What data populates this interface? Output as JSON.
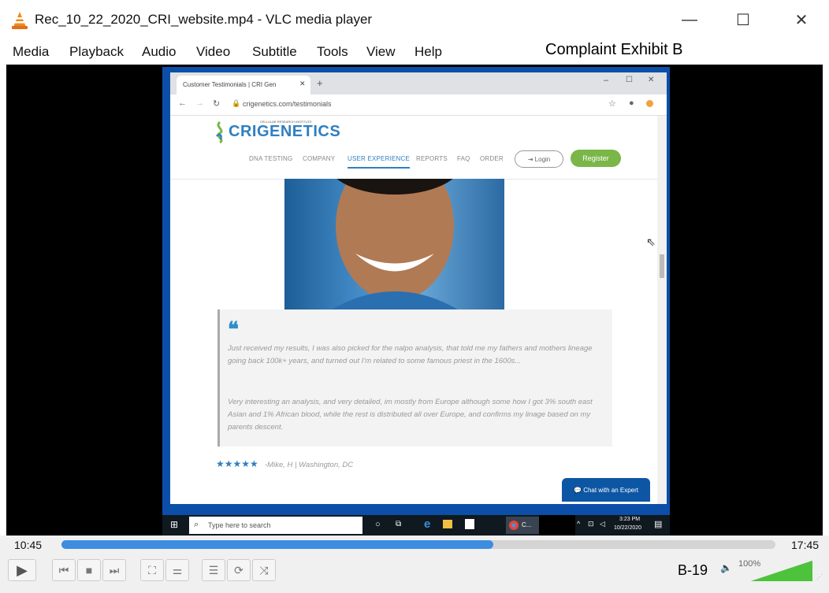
{
  "window": {
    "title": "Rec_10_22_2020_CRI_website.mp4 - VLC media player",
    "controls": [
      "—",
      "☐",
      "✕"
    ]
  },
  "menubar": {
    "items": [
      "Media",
      "Playback",
      "Audio",
      "Video",
      "Subtitle",
      "Tools",
      "View",
      "Help"
    ]
  },
  "exhibit_label": "Complaint Exhibit B",
  "browser": {
    "tab_title": "Customer Testimonials | CRI Gen",
    "url": "crigenetics.com/testimonials",
    "logo_text": "CRIGENETICS",
    "logo_tagline": "CELLULAR RESEARCH INSTITUTE",
    "nav": [
      "DNA TESTING",
      "COMPANY",
      "USER EXPERIENCE",
      "REPORTS",
      "FAQ",
      "ORDER"
    ],
    "login": "Login",
    "register": "Register",
    "quote_p1": "Just received my results, I was also picked for the nalpo analysis, that told me my fathers and mothers lineage going back 100k+ years, and turned out I'm related to some famous priest in the 1600s...",
    "quote_p2": "Very interesting an analysis, and very detailed, im mostly from Europe although some how I got 3% south east Asian and 1% African blood, while the rest is distributed all over Europe, and confirms my linage based on my parents descent.",
    "stars": "★★★★★",
    "attribution": "-Mike, H | Washington, DC",
    "chat": "Chat with an Expert"
  },
  "taskbar": {
    "search_placeholder": "Type here to search",
    "time": "3:23 PM",
    "date": "10/22/2020",
    "chrome_label": "C..."
  },
  "player": {
    "current_time": "10:45",
    "total_time": "17:45",
    "progress": 0.605,
    "exhibit_number": "B-19",
    "volume": "100%"
  }
}
